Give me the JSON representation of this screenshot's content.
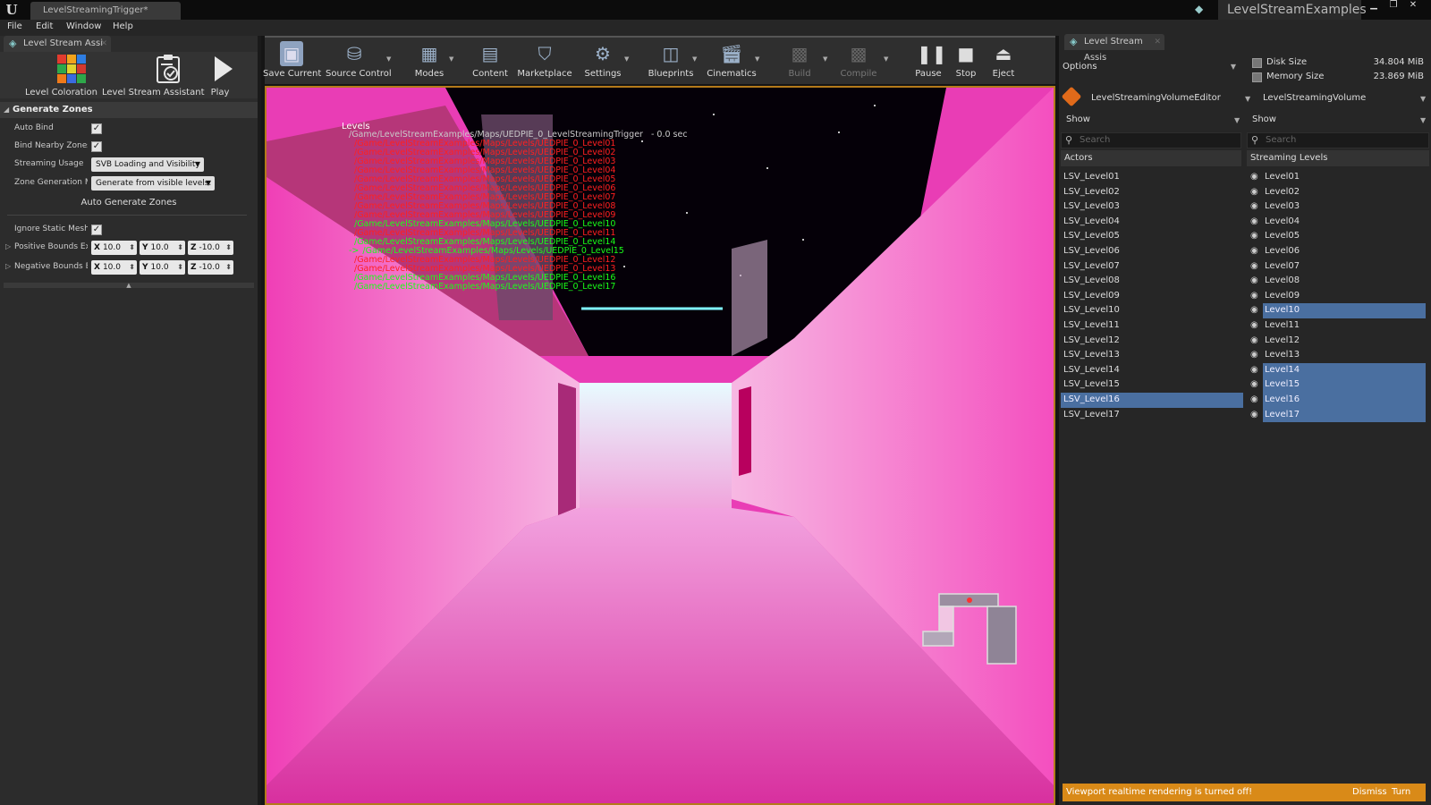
{
  "window": {
    "doc_tab": "LevelStreamingTrigger*",
    "project_name": "LevelStreamExamples",
    "logo_glyph": "U"
  },
  "menu": [
    "File",
    "Edit",
    "Window",
    "Help"
  ],
  "left_panel": {
    "tab": "Level Stream Assi",
    "tools": [
      {
        "label": "Level Coloration",
        "icon": "color-grid-icon"
      },
      {
        "label": "Level Stream Assistant",
        "icon": "clipboard-check-icon"
      },
      {
        "label": "Play",
        "icon": "play-icon"
      }
    ],
    "section": "Generate Zones",
    "props": {
      "auto_bind": {
        "label": "Auto Bind",
        "checked": true
      },
      "bind_nearby": {
        "label": "Bind Nearby Zones",
        "checked": true
      },
      "streaming_usage": {
        "label": "Streaming Usage",
        "value": "SVB Loading and Visibility"
      },
      "zone_generation": {
        "label": "Zone Generation Mc",
        "value": "Generate from visible levels."
      },
      "auto_generate": "Auto Generate Zones",
      "ignore_static": {
        "label": "Ignore Static Mesh",
        "checked": true
      },
      "positive_bounds": {
        "label": "Positive Bounds Ex",
        "x": "10.0",
        "y": "10.0",
        "z": "-10.0"
      },
      "negative_bounds": {
        "label": "Negative Bounds E:",
        "x": "10.0",
        "y": "10.0",
        "z": "-10.0"
      }
    }
  },
  "toolbar": [
    {
      "label": "Save Current",
      "icon": "save-icon",
      "disabled": false
    },
    {
      "label": "Source Control",
      "icon": "source-control-icon",
      "disabled": false
    },
    {
      "label": "Modes",
      "icon": "modes-icon",
      "disabled": false
    },
    {
      "label": "Content",
      "icon": "content-icon",
      "disabled": false
    },
    {
      "label": "Marketplace",
      "icon": "marketplace-icon",
      "disabled": false
    },
    {
      "label": "Settings",
      "icon": "settings-icon",
      "disabled": false
    },
    {
      "label": "Blueprints",
      "icon": "blueprints-icon",
      "disabled": false
    },
    {
      "label": "Cinematics",
      "icon": "cinematics-icon",
      "disabled": false
    },
    {
      "label": "Build",
      "icon": "build-icon",
      "disabled": true
    },
    {
      "label": "Compile",
      "icon": "compile-icon",
      "disabled": true
    },
    {
      "label": "Pause",
      "icon": "pause-icon",
      "disabled": false
    },
    {
      "label": "Stop",
      "icon": "stop-icon",
      "disabled": false
    },
    {
      "label": "Eject",
      "icon": "eject-icon",
      "disabled": false
    }
  ],
  "viewport": {
    "levels_title": "Levels",
    "persistent": "/Game/LevelStreamExamples/Maps/UEDPIE_0_LevelStreamingTrigger",
    "persistent_time": "-  0.0 sec",
    "current_marker": "->",
    "levels": [
      {
        "path": "/Game/LevelStreamExamples/Maps/Levels/UEDPIE_0_Level01",
        "state": "unloaded"
      },
      {
        "path": "/Game/LevelStreamExamples/Maps/Levels/UEDPIE_0_Level02",
        "state": "unloaded"
      },
      {
        "path": "/Game/LevelStreamExamples/Maps/Levels/UEDPIE_0_Level03",
        "state": "unloaded"
      },
      {
        "path": "/Game/LevelStreamExamples/Maps/Levels/UEDPIE_0_Level04",
        "state": "unloaded"
      },
      {
        "path": "/Game/LevelStreamExamples/Maps/Levels/UEDPIE_0_Level05",
        "state": "unloaded"
      },
      {
        "path": "/Game/LevelStreamExamples/Maps/Levels/UEDPIE_0_Level06",
        "state": "unloaded"
      },
      {
        "path": "/Game/LevelStreamExamples/Maps/Levels/UEDPIE_0_Level07",
        "state": "unloaded"
      },
      {
        "path": "/Game/LevelStreamExamples/Maps/Levels/UEDPIE_0_Level08",
        "state": "unloaded"
      },
      {
        "path": "/Game/LevelStreamExamples/Maps/Levels/UEDPIE_0_Level09",
        "state": "unloaded"
      },
      {
        "path": "/Game/LevelStreamExamples/Maps/Levels/UEDPIE_0_Level10",
        "state": "loaded"
      },
      {
        "path": "/Game/LevelStreamExamples/Maps/Levels/UEDPIE_0_Level11",
        "state": "unloaded"
      },
      {
        "path": "/Game/LevelStreamExamples/Maps/Levels/UEDPIE_0_Level14",
        "state": "loaded"
      },
      {
        "path": "/Game/LevelStreamExamples/Maps/Levels/UEDPIE_0_Level15",
        "state": "current"
      },
      {
        "path": "/Game/LevelStreamExamples/Maps/Levels/UEDPIE_0_Level12",
        "state": "unloaded"
      },
      {
        "path": "/Game/LevelStreamExamples/Maps/Levels/UEDPIE_0_Level13",
        "state": "unloaded"
      },
      {
        "path": "/Game/LevelStreamExamples/Maps/Levels/UEDPIE_0_Level16",
        "state": "loaded"
      },
      {
        "path": "/Game/LevelStreamExamples/Maps/Levels/UEDPIE_0_Level17",
        "state": "loaded"
      }
    ]
  },
  "right_panel": {
    "tab": "Level Stream Assis",
    "options": "Options",
    "disk_size_label": "Disk Size",
    "disk_size_value": "34.804 MiB",
    "memory_size_label": "Memory Size",
    "memory_size_value": "23.869 MiB",
    "editor_name": "LevelStreamingVolumeEditor",
    "volume_name": "LevelStreamingVolume",
    "show_left": "Show",
    "show_right": "Show",
    "search_left": "Search",
    "search_right": "Search",
    "actors_header": "Actors",
    "streaming_header": "Streaming Levels",
    "actors": [
      {
        "name": "LSV_Level01",
        "selected": false
      },
      {
        "name": "LSV_Level02",
        "selected": false
      },
      {
        "name": "LSV_Level03",
        "selected": false
      },
      {
        "name": "LSV_Level04",
        "selected": false
      },
      {
        "name": "LSV_Level05",
        "selected": false
      },
      {
        "name": "LSV_Level06",
        "selected": false
      },
      {
        "name": "LSV_Level07",
        "selected": false
      },
      {
        "name": "LSV_Level08",
        "selected": false
      },
      {
        "name": "LSV_Level09",
        "selected": false
      },
      {
        "name": "LSV_Level10",
        "selected": false
      },
      {
        "name": "LSV_Level11",
        "selected": false
      },
      {
        "name": "LSV_Level12",
        "selected": false
      },
      {
        "name": "LSV_Level13",
        "selected": false
      },
      {
        "name": "LSV_Level14",
        "selected": false
      },
      {
        "name": "LSV_Level15",
        "selected": false
      },
      {
        "name": "LSV_Level16",
        "selected": true
      },
      {
        "name": "LSV_Level17",
        "selected": false
      }
    ],
    "streaming_levels": [
      {
        "name": "Level01",
        "selected": false
      },
      {
        "name": "Level02",
        "selected": false
      },
      {
        "name": "Level03",
        "selected": false
      },
      {
        "name": "Level04",
        "selected": false
      },
      {
        "name": "Level05",
        "selected": false
      },
      {
        "name": "Level06",
        "selected": false
      },
      {
        "name": "Level07",
        "selected": false
      },
      {
        "name": "Level08",
        "selected": false
      },
      {
        "name": "Level09",
        "selected": false
      },
      {
        "name": "Level10",
        "selected": true
      },
      {
        "name": "Level11",
        "selected": false
      },
      {
        "name": "Level12",
        "selected": false
      },
      {
        "name": "Level13",
        "selected": false
      },
      {
        "name": "Level14",
        "selected": true
      },
      {
        "name": "Level15",
        "selected": true
      },
      {
        "name": "Level16",
        "selected": true
      },
      {
        "name": "Level17",
        "selected": true
      }
    ],
    "notification": {
      "text": "Viewport realtime rendering is turned off!",
      "dismiss": "Dismiss",
      "turn_on": "Turn On"
    }
  },
  "colors": {
    "accent_selection": "#4a6fa0",
    "notification": "#d98a18",
    "loaded_level": "#19ff19",
    "unloaded_level": "#ff2020",
    "viewport_wall": "#ea3fb6"
  }
}
